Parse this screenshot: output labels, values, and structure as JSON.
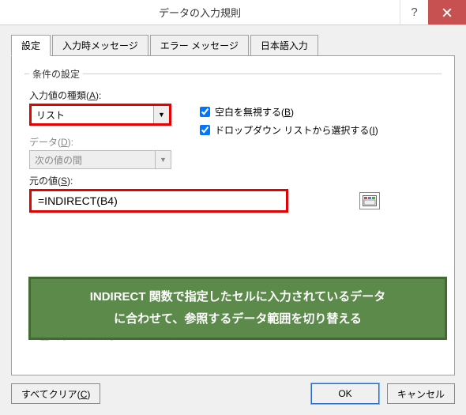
{
  "titlebar": {
    "title": "データの入力規則",
    "help_symbol": "?"
  },
  "tabs": {
    "items": [
      {
        "label": "設定"
      },
      {
        "label": "入力時メッセージ"
      },
      {
        "label": "エラー メッセージ"
      },
      {
        "label": "日本語入力"
      }
    ],
    "active_index": 0
  },
  "fieldset_legend": "条件の設定",
  "allow": {
    "label_pre": "入力値の種類(",
    "label_key": "A",
    "label_post": "):",
    "value": "リスト"
  },
  "ignore_blank": {
    "checked": true,
    "label_pre": "空白を無視する(",
    "label_key": "B",
    "label_post": ")"
  },
  "dropdown_list": {
    "checked": true,
    "label_pre": "ドロップダウン リストから選択する(",
    "label_key": "I",
    "label_post": ")"
  },
  "data": {
    "label_pre": "データ(",
    "label_key": "D",
    "label_post": "):",
    "value": "次の値の間"
  },
  "source": {
    "label_pre": "元の値(",
    "label_key": "S",
    "label_post": "):",
    "value": "=INDIRECT(B4)"
  },
  "apply_others": {
    "checked": false,
    "label": "同じ入力規則が設定された他のセルにも適用する"
  },
  "callout": {
    "line1": "INDIRECT 関数で指定したセルに入力されているデータ",
    "line2": "に合わせて、参照するデータ範囲を切り替える"
  },
  "buttons": {
    "clear_pre": "すべてクリア(",
    "clear_key": "C",
    "clear_post": ")",
    "ok": "OK",
    "cancel": "キャンセル"
  }
}
